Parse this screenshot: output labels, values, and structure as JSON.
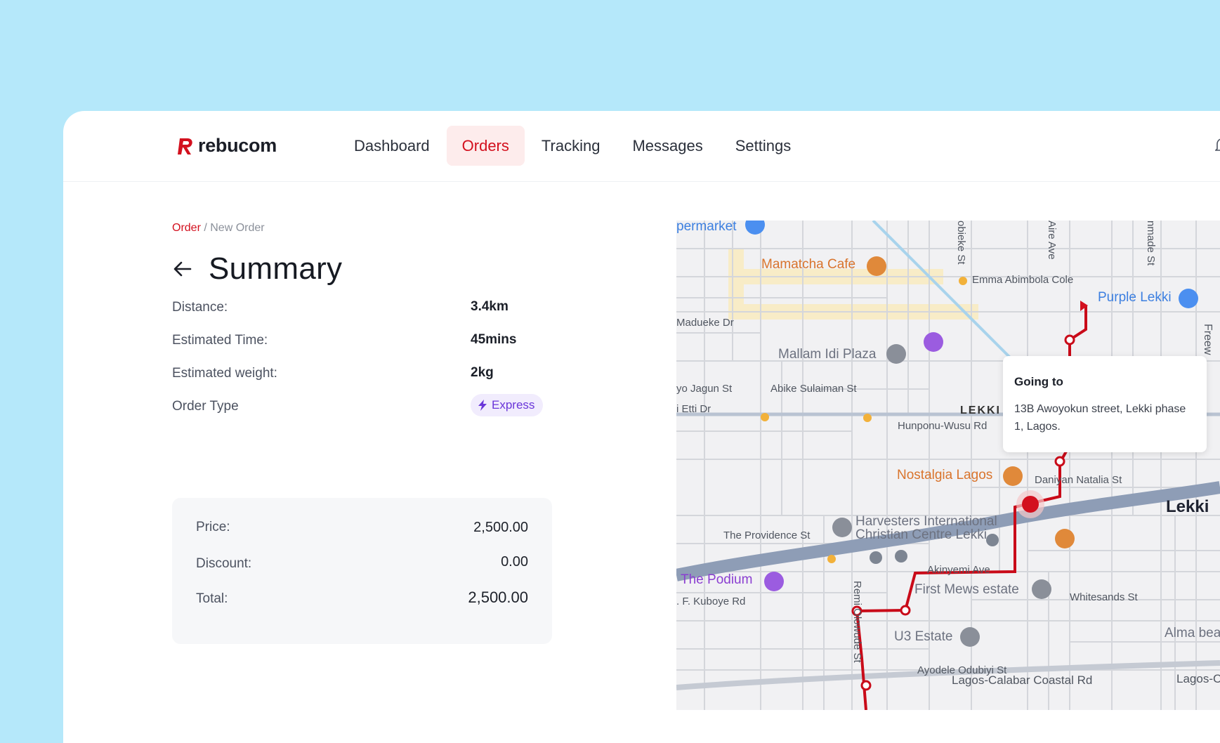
{
  "brand": {
    "name": "rebucom",
    "color": "#d3101e"
  },
  "nav": {
    "items": [
      {
        "label": "Dashboard",
        "active": false
      },
      {
        "label": "Orders",
        "active": true
      },
      {
        "label": "Tracking",
        "active": false
      },
      {
        "label": "Messages",
        "active": false
      },
      {
        "label": "Settings",
        "active": false
      }
    ]
  },
  "breadcrumb": {
    "link": "Order",
    "separator": " / ",
    "current": "New Order"
  },
  "page": {
    "title": "Summary"
  },
  "details": [
    {
      "label": "Distance:",
      "value": "3.4km"
    },
    {
      "label": "Estimated Time:",
      "value": "45mins"
    },
    {
      "label": "Estimated weight:",
      "value": "2kg"
    },
    {
      "label": "Order Type",
      "badge": "Express"
    }
  ],
  "pricing": {
    "price": {
      "label": "Price:",
      "value": "2,500.00"
    },
    "discount": {
      "label": "Discount:",
      "value": "0.00"
    },
    "total": {
      "label": "Total:",
      "value": "2,500.00"
    }
  },
  "map": {
    "labels": [
      "permarket",
      "Mamatcha Cafe",
      "Emma Abimbola Cole",
      "Purple Lekki",
      "Madueke Dr",
      "Mallam Idi Plaza",
      "yo Jagun St",
      "Abike Sulaiman St",
      "i Etti Dr",
      "LEKKI",
      "Hunponu-Wusu Rd",
      "Nostalgia Lagos",
      "Daniyan Natalia St",
      "Lekki",
      "Harvesters International",
      "Christian Centre Lekki",
      "The Providence St",
      "The Podium",
      "Akinyemi Ave",
      "First Mews estate",
      "Whitesands St",
      ". F. Kuboye Rd",
      "U3 Estate",
      "Alma bea",
      "Ayodele Odubiyi St",
      "Lagos-Calabar Coastal Rd",
      "Lagos-C",
      "obieke St",
      "Aire Ave",
      "nmade St",
      "Freew",
      "Remi Olowude St"
    ]
  },
  "tooltip": {
    "title": "Going to",
    "address": "13B Awoyokun street, Lekki phase 1, Lagos."
  }
}
